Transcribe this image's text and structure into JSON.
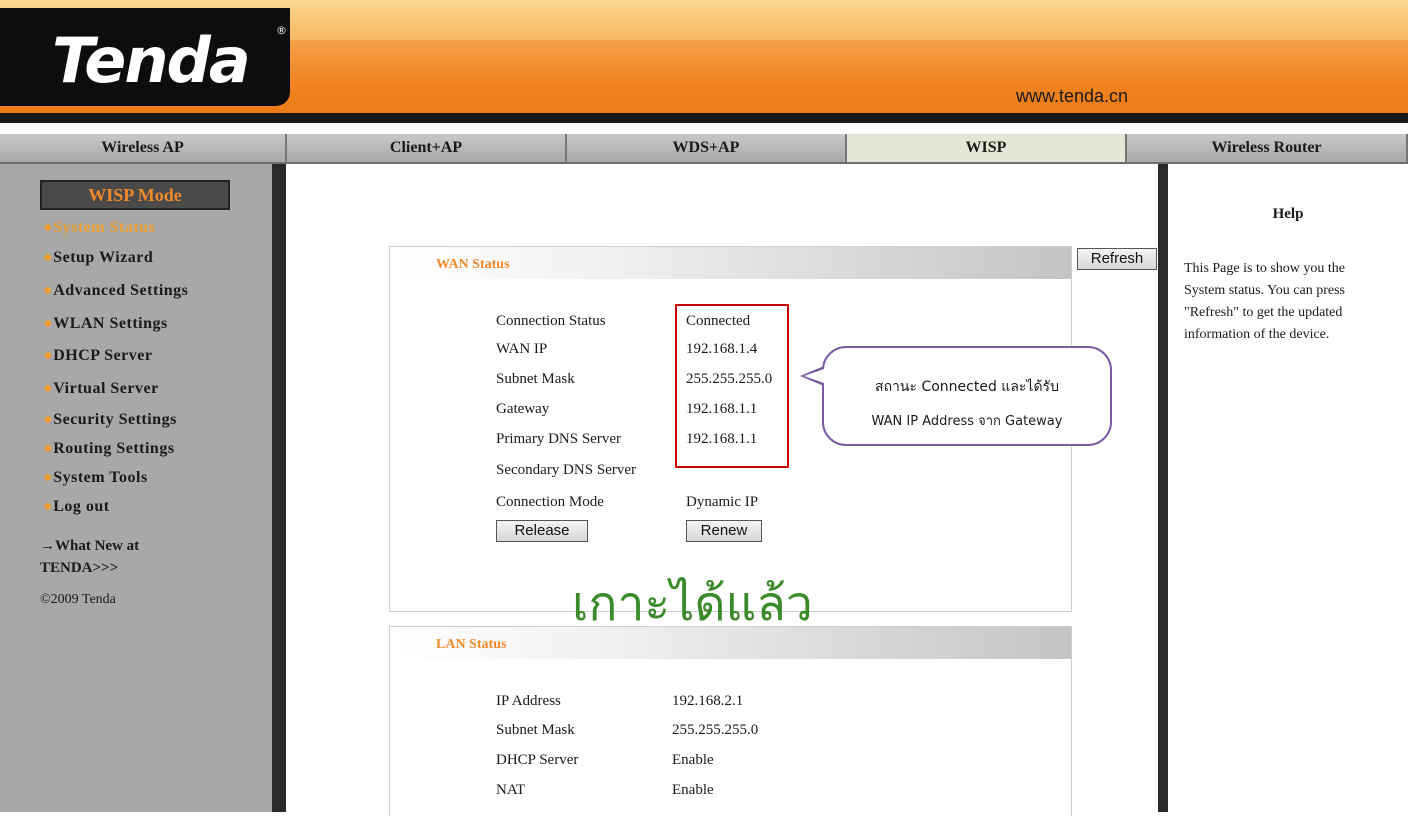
{
  "header": {
    "logo": "Tenda",
    "logo_mark": "®",
    "url": "www.tenda.cn"
  },
  "tabs": [
    {
      "label": "Wireless AP",
      "active": false
    },
    {
      "label": "Client+AP",
      "active": false
    },
    {
      "label": "WDS+AP",
      "active": false
    },
    {
      "label": "WISP",
      "active": true
    },
    {
      "label": "Wireless Router",
      "active": false
    }
  ],
  "sidebar": {
    "mode_title": "WISP Mode",
    "items": [
      {
        "label": "System Status",
        "current": true
      },
      {
        "label": "Setup Wizard"
      },
      {
        "label": "Advanced Settings"
      },
      {
        "label": "WLAN Settings"
      },
      {
        "label": "DHCP Server"
      },
      {
        "label": "Virtual Server"
      },
      {
        "label": "Security Settings"
      },
      {
        "label": "Routing Settings"
      },
      {
        "label": "System Tools"
      },
      {
        "label": "Log out"
      }
    ],
    "whats_new_line1": "→What New at",
    "whats_new_line2": "TENDA>>>",
    "copyright": "©2009 Tenda"
  },
  "wan": {
    "title": "WAN Status",
    "refresh_label": "Refresh",
    "rows": [
      {
        "label": "Connection Status",
        "value": "Connected"
      },
      {
        "label": "WAN IP",
        "value": "192.168.1.4"
      },
      {
        "label": "Subnet Mask",
        "value": "255.255.255.0"
      },
      {
        "label": "Gateway",
        "value": "192.168.1.1"
      },
      {
        "label": "Primary DNS Server",
        "value": "192.168.1.1"
      },
      {
        "label": "Secondary DNS Server",
        "value": ""
      },
      {
        "label": "Connection Mode",
        "value": "Dynamic IP"
      }
    ],
    "release_label": "Release",
    "renew_label": "Renew"
  },
  "annotation": {
    "line1": "สถานะ Connected และได้รับ",
    "line2": "WAN IP Address จาก Gateway",
    "big_text": "เกาะได้แล้ว",
    "highlight_color": "#c40000",
    "bubble_color": "#7b5aa6",
    "big_text_color": "#3a8a2a"
  },
  "lan": {
    "title": "LAN Status",
    "rows": [
      {
        "label": "IP Address",
        "value": "192.168.2.1"
      },
      {
        "label": "Subnet Mask",
        "value": "255.255.255.0"
      },
      {
        "label": "DHCP Server",
        "value": "Enable"
      },
      {
        "label": "NAT",
        "value": "Enable"
      }
    ]
  },
  "help": {
    "title": "Help",
    "text": "This Page is to show you the System status. You can press \"Refresh\" to get the updated information of the device."
  },
  "colors": {
    "accent": "#f08a2a",
    "header_orange": "#ef8320",
    "sidebar_bg": "#a8a8a8"
  }
}
